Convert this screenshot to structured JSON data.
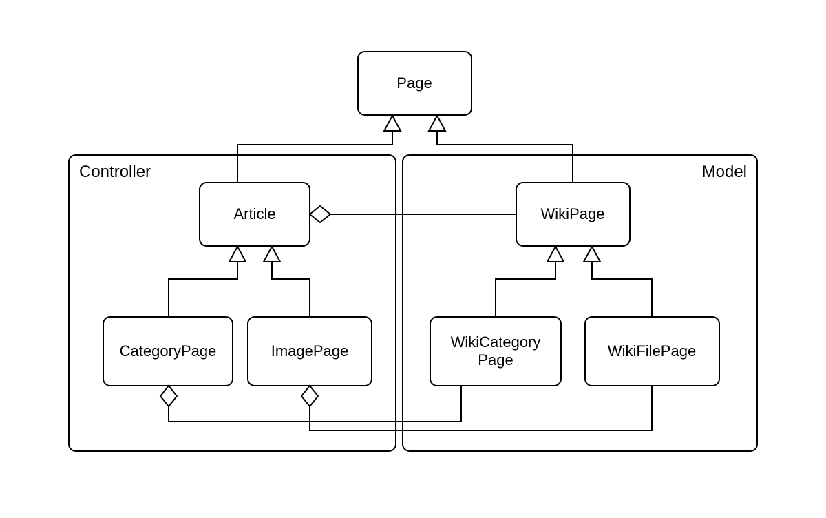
{
  "classes": {
    "page": "Page",
    "article": "Article",
    "wikipage": "WikiPage",
    "categorypage": "CategoryPage",
    "imagepage": "ImagePage",
    "wikicategorypage_l1": "WikiCategory",
    "wikicategorypage_l2": "Page",
    "wikifilepage": "WikiFilePage"
  },
  "containers": {
    "controller": "Controller",
    "model": "Model"
  },
  "relationships": [
    {
      "type": "generalization",
      "from": "Article",
      "to": "Page"
    },
    {
      "type": "generalization",
      "from": "WikiPage",
      "to": "Page"
    },
    {
      "type": "generalization",
      "from": "CategoryPage",
      "to": "Article"
    },
    {
      "type": "generalization",
      "from": "ImagePage",
      "to": "Article"
    },
    {
      "type": "generalization",
      "from": "WikiCategoryPage",
      "to": "WikiPage"
    },
    {
      "type": "generalization",
      "from": "WikiFilePage",
      "to": "WikiPage"
    },
    {
      "type": "aggregation",
      "whole": "Article",
      "part": "WikiPage"
    },
    {
      "type": "aggregation",
      "whole": "CategoryPage",
      "part": "WikiCategoryPage"
    },
    {
      "type": "aggregation",
      "whole": "ImagePage",
      "part": "WikiFilePage"
    }
  ]
}
